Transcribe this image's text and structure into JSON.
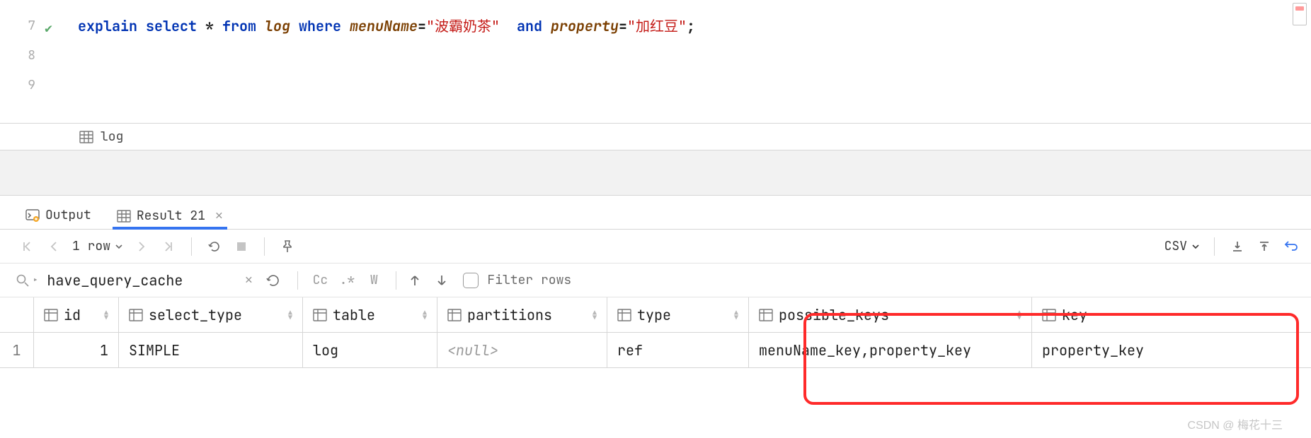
{
  "editor": {
    "lines": [
      "7",
      "8",
      "9"
    ],
    "sql": {
      "explain": "explain",
      "select": "select",
      "star": "*",
      "from": "from",
      "table": "log",
      "where": "where",
      "col1": "menuName",
      "eq": "=",
      "val1": "\"波霸奶茶\"",
      "and": "and",
      "col2": "property",
      "val2": "\"加红豆\"",
      "semi": ";"
    }
  },
  "breadcrumb": {
    "item": "log"
  },
  "tabs": {
    "output": "Output",
    "result": "Result 21"
  },
  "toolbar": {
    "rowcount": "1 row",
    "csv": "CSV"
  },
  "filter": {
    "query": "have_query_cache",
    "cc": "Cc",
    "star": ".*",
    "w": "W",
    "label": "Filter rows"
  },
  "grid": {
    "columns": [
      "id",
      "select_type",
      "table",
      "partitions",
      "type",
      "possible_keys",
      "key"
    ],
    "rows": [
      {
        "n": "1",
        "id": "1",
        "select_type": "SIMPLE",
        "table": "log",
        "partitions": "<null>",
        "type": "ref",
        "possible_keys": "menuName_key,property_key",
        "key": "property_key"
      }
    ]
  },
  "watermark": "CSDN @ 梅花十三"
}
